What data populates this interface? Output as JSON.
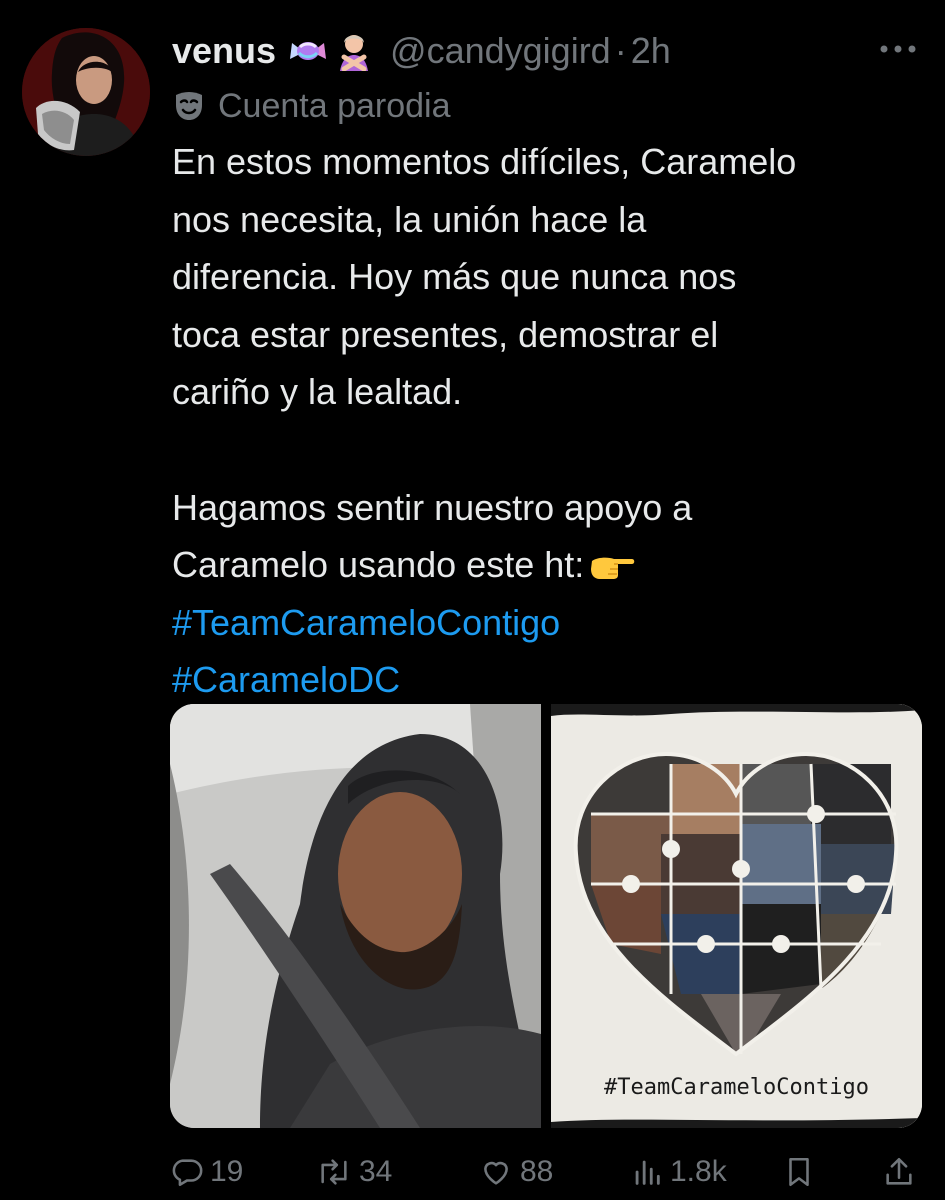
{
  "tweet": {
    "display_name": "venus",
    "handle": "@candygigird",
    "separator": "·",
    "time": "2h",
    "parody_label": "Cuenta parodia",
    "body_lines": [
      "En estos momentos difíciles, Caramelo",
      "nos necesita, la unión hace la",
      "diferencia. Hoy más que nunca nos",
      "toca estar presentes, demostrar el",
      "cariño y la lealtad."
    ],
    "body_line_2a": "Hagamos sentir nuestro apoyo a",
    "body_line_2b": "Caramelo usando este ht:",
    "hashtags": [
      "#TeamCarameloContigo",
      "#CarameloDC"
    ],
    "collage_caption": "#TeamCarameloContigo"
  },
  "actions": {
    "replies": "19",
    "reposts": "34",
    "likes": "88",
    "views": "1.8k"
  },
  "icons": {
    "name_emoji_1": "candy-icon",
    "name_emoji_2": "person-gesturing-no-icon",
    "parody": "mask-icon",
    "pointing": "backhand-index-pointing-right-icon",
    "more": "more-dots-icon",
    "reply": "reply-icon",
    "repost": "repost-icon",
    "like": "heart-icon",
    "views": "views-icon",
    "bookmark": "bookmark-icon",
    "share": "share-icon"
  },
  "colors": {
    "background": "#000000",
    "text": "#e7e9ea",
    "secondary": "#71767b",
    "link": "#1d9bf0"
  }
}
